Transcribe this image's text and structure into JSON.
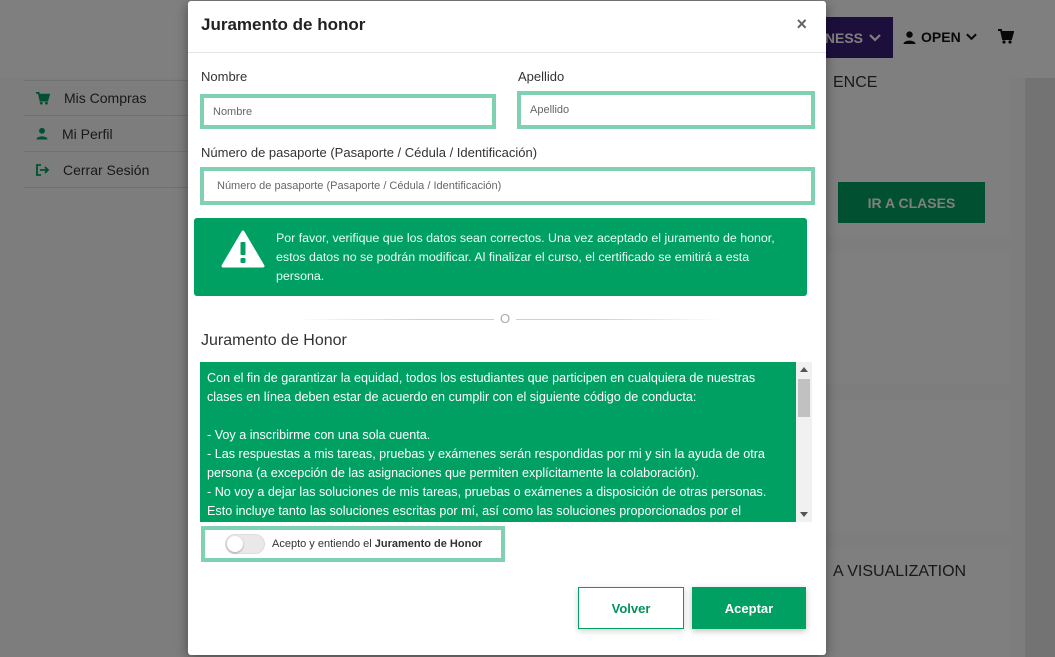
{
  "background": {
    "nav": {
      "business_label": "NESS",
      "open_label": "OPEN"
    },
    "sidebar": {
      "items": [
        {
          "label": "Mis Compras",
          "icon": "cart-icon"
        },
        {
          "label": "Mi Perfil",
          "icon": "user-icon"
        },
        {
          "label": "Cerrar Sesión",
          "icon": "sign-out-icon"
        }
      ]
    },
    "cards": {
      "title_1": "ENCE",
      "class_button": "IR A CLASES",
      "title_2": "A VISUALIZATION"
    }
  },
  "modal": {
    "title": "Juramento de honor",
    "close_symbol": "×",
    "fields": {
      "first_name_label": "Nombre",
      "first_name_placeholder": "Nombre",
      "first_name_value": "",
      "last_name_label": "Apellido",
      "last_name_placeholder": "Apellido",
      "last_name_value": "",
      "passport_label": "Número de pasaporte (Pasaporte / Cédula / Identificación)",
      "passport_placeholder": "Número de pasaporte (Pasaporte / Cédula / Identificación)",
      "passport_value": ""
    },
    "alert": {
      "icon": "warning-icon",
      "text": "Por favor, verifique que los datos sean correctos. Una vez aceptado el juramento de honor, estos datos no se podrán modificar. Al finalizar el curso, el certificado se emitirá a esta persona."
    },
    "divider_text": "O",
    "oath": {
      "heading": "Juramento de Honor",
      "intro": "Con el fin de garantizar la equidad, todos los estudiantes que participen en cualquiera de nuestras clases en línea deben estar de acuerdo en cumplir con el siguiente código de conducta:",
      "line_1": "- Voy a inscribirme con una sola cuenta.",
      "line_2": "- Las respuestas a mis tareas, pruebas y exámenes serán respondidas por mi y sin la ayuda de otra persona (a excepción de las asignaciones que permiten explícitamente la colaboración).",
      "line_3": "- No voy a dejar las soluciones de mis tareas, pruebas o exámenes a disposición de otras personas. Esto incluye tanto las soluciones escritas por mí, así como las soluciones proporcionados por el"
    },
    "accept": {
      "label_prefix": "Acepto y entiendo el",
      "label_bold": "Juramento de Honor",
      "checked": false
    },
    "buttons": {
      "back": "Volver",
      "accept": "Aceptar"
    },
    "colors": {
      "primary_green": "#00a063",
      "input_border": "#7fd1b2",
      "brand_purple": "#3b1f78"
    }
  }
}
